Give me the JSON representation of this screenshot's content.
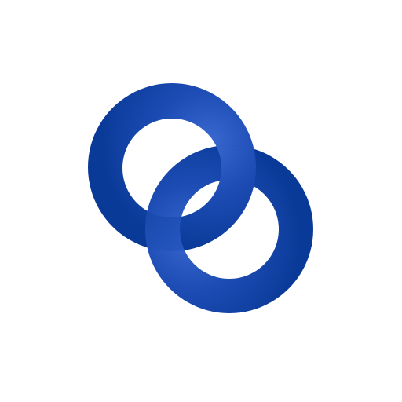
{
  "icon": {
    "name": "interlocking-rings-icon",
    "description_visible_text": ""
  },
  "colors": {
    "background": "#ffffff",
    "ring_dark": "#0a3a98",
    "ring_mid": "#123f9c",
    "ring_highlight": "#3a6ad0"
  }
}
